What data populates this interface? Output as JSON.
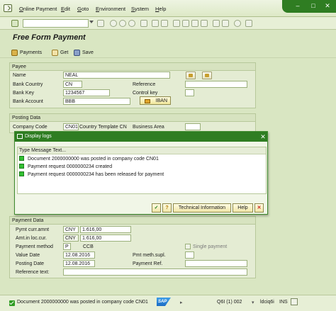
{
  "menu": [
    "Online Payment",
    "Edit",
    "Goto",
    "Environment",
    "System",
    "Help"
  ],
  "page_title": "Free Form Payment",
  "app_toolbar": {
    "payments": "Payments",
    "get": "Get",
    "save": "Save"
  },
  "payee": {
    "header": "Payee",
    "name_label": "Name",
    "name_value": "NEAL",
    "bank_country_label": "Bank Country",
    "bank_country_value": "CN",
    "bank_key_label": "Bank Key",
    "bank_key_value": "1234567",
    "bank_account_label": "Bank Account",
    "bank_account_value": "BBB",
    "reference_label": "Reference",
    "control_key_label": "Control key",
    "iban_label": "IBAN"
  },
  "posting": {
    "header": "Posting Data",
    "company_code_label": "Company Code",
    "company_code_value": "CN01",
    "country_template_label": "Country Template CN",
    "business_area_label": "Business Area"
  },
  "payment": {
    "header": "Payment Data",
    "pymt_curr_label": "Pymt curr.amnt",
    "pymt_curr_cur": "CNY",
    "pymt_curr_amt": "1.616,00",
    "amt_loc_label": "Amt.in loc.cur.",
    "amt_loc_cur": "CNY",
    "amt_loc_amt": "1.616,00",
    "method_label": "Payment method",
    "method_value": "P",
    "method_desc": "CCB",
    "single_payment_label": "Single payment",
    "value_date_label": "Value Date",
    "value_date": "12.08.2016",
    "pmt_meth_supl_label": "Pmt meth.supl.",
    "posting_date_label": "Posting Date",
    "posting_date": "12.08.2016",
    "payment_ref_label": "Payment Ref.",
    "reference_text_label": "Reference text:"
  },
  "dialog": {
    "title": "Display logs",
    "header": "Type Message Text...",
    "messages": [
      "Document 2000000000 was posted in company code CN01",
      "Payment request 0000000234 created",
      "Payment request 0000000234 has been released for payment"
    ],
    "technical_info": "Technical Information",
    "help": "Help"
  },
  "status": {
    "message": "Document 2000000000 was posted in company code CN01",
    "sap_logo": "SAP",
    "system": "Q6I (1) 002",
    "server": "ldciq6i",
    "mode": "INS"
  }
}
